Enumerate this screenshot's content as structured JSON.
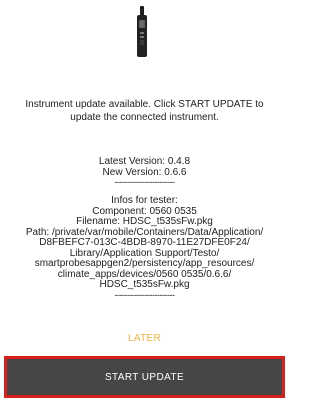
{
  "icons": {
    "device": "handheld-probe-icon"
  },
  "message": {
    "line1": "Instrument update available. Click START UPDATE to",
    "line2": "update the connected instrument."
  },
  "versions": {
    "latest": "Latest Version: 0.4.8",
    "new": "New Version: 0.6.6",
    "separator": "------------------------"
  },
  "tester_info": {
    "heading": "Infos for tester:",
    "component": "Component: 0560 0535",
    "filename": "Filename: HDSC_t535sFw.pkg",
    "path_lines": [
      "Path: /private/var/mobile/Containers/Data/Application/",
      "D8FBEFC7-013C-4BDB-8970-11E27DFE0F24/",
      "Library/Application Support/Testo/",
      "smartprobesappgen2/persistency/app_resources/",
      "climate_apps/devices/0560 0535/0.6.6/",
      "HDSC_t535sFw.pkg"
    ],
    "separator": "------------------------"
  },
  "actions": {
    "later_label": "LATER",
    "start_label": "START UPDATE"
  },
  "colors": {
    "later": "#f5b041",
    "start_bg": "#464646",
    "highlight_border": "#d9201b"
  }
}
